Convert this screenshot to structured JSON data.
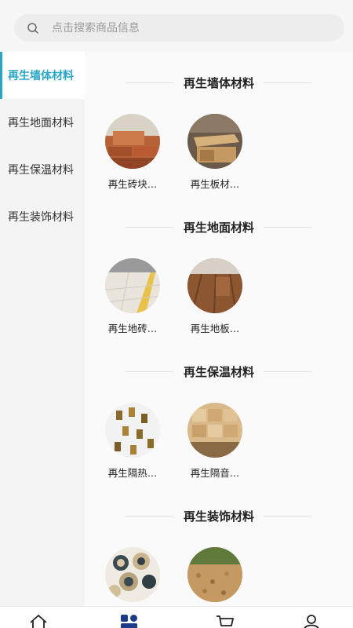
{
  "search": {
    "placeholder": "点击搜索商品信息"
  },
  "sidebar": {
    "items": [
      {
        "label": "再生墙体材料"
      },
      {
        "label": "再生地面材料"
      },
      {
        "label": "再生保温材料"
      },
      {
        "label": "再生装饰材料"
      }
    ]
  },
  "sections": [
    {
      "title": "再生墙体材料",
      "products": [
        {
          "label": "再生砖块…"
        },
        {
          "label": "再生板材…"
        }
      ]
    },
    {
      "title": "再生地面材料",
      "products": [
        {
          "label": "再生地砖…"
        },
        {
          "label": "再生地板…"
        }
      ]
    },
    {
      "title": "再生保温材料",
      "products": [
        {
          "label": "再生隔热…"
        },
        {
          "label": "再生隔音…"
        }
      ]
    },
    {
      "title": "再生装饰材料",
      "products": [
        {
          "label": ""
        },
        {
          "label": ""
        }
      ]
    }
  ],
  "tabbar": {
    "icons": [
      "home-icon",
      "category-icon",
      "cart-icon",
      "user-icon"
    ],
    "accent": "#1e3a8a"
  },
  "colors": {
    "accent": "#2aa6c6"
  }
}
